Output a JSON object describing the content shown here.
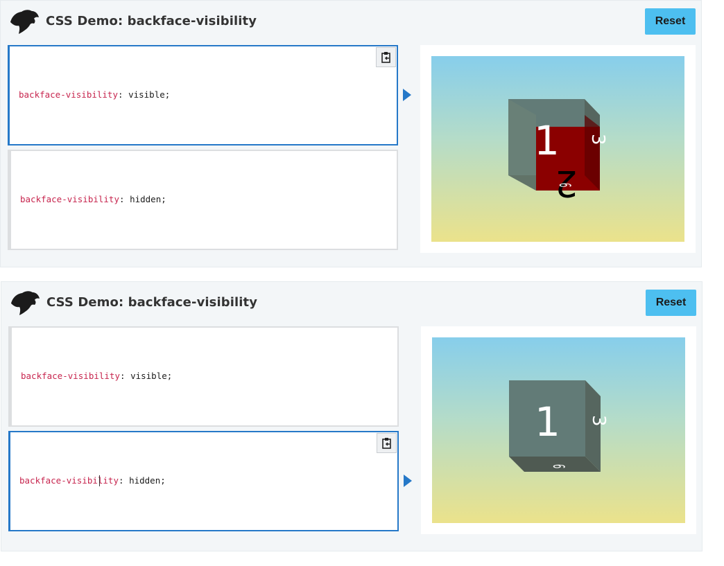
{
  "demos": [
    {
      "title": "CSS Demo: backface-visibility",
      "reset_label": "Reset",
      "examples": [
        {
          "property": "backface-visibility",
          "sep": ": ",
          "value": "visible;"
        },
        {
          "property": "backface-visibility",
          "sep": ": ",
          "value": "hidden;"
        }
      ],
      "active_example": 0,
      "cube_faces": {
        "front": "2",
        "back": "1",
        "right": "3",
        "bottom": "6"
      },
      "colors": {
        "accent": "#2578c8",
        "reset": "#4dbff0",
        "front_face": "#8b0000"
      }
    },
    {
      "title": "CSS Demo: backface-visibility",
      "reset_label": "Reset",
      "examples": [
        {
          "property": "backface-visibility",
          "sep": ": ",
          "value": "visible;"
        },
        {
          "property": "backface-visibility",
          "sep": ": ",
          "value": "hidden;"
        }
      ],
      "active_example": 1,
      "cube_faces": {
        "back": "1",
        "right": "3",
        "bottom": "6"
      },
      "colors": {
        "accent": "#2578c8",
        "reset": "#4dbff0"
      }
    }
  ]
}
